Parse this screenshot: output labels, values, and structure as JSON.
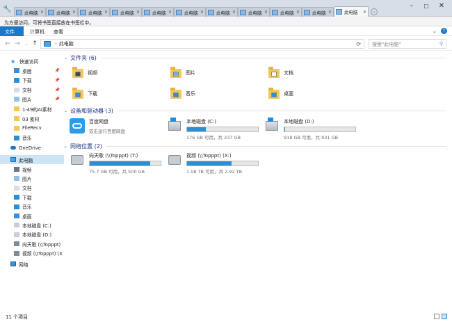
{
  "tabs": [
    {
      "label": "此电脑"
    },
    {
      "label": "此电脑"
    },
    {
      "label": "此电脑"
    },
    {
      "label": "此电脑"
    },
    {
      "label": "此电脑"
    },
    {
      "label": "此电脑"
    },
    {
      "label": "此电脑"
    },
    {
      "label": "此电脑"
    },
    {
      "label": "此电脑"
    },
    {
      "label": "此电脑"
    },
    {
      "label": "此电脑"
    }
  ],
  "notice": "为方便访问，可将书签直接放在书签栏中。",
  "ribbon": {
    "file": "文件",
    "computer": "计算机",
    "view": "查看"
  },
  "address": {
    "path": "此电脑",
    "search_placeholder": "搜索\"此电脑\""
  },
  "nav": {
    "quick_access": "快速访问",
    "qa_items": [
      {
        "label": "桌面",
        "icon": "desktop-icon",
        "pinned": true
      },
      {
        "label": "下载",
        "icon": "download-icon",
        "pinned": true
      },
      {
        "label": "文档",
        "icon": "document-icon",
        "pinned": true
      },
      {
        "label": "图片",
        "icon": "picture-icon",
        "pinned": true
      },
      {
        "label": "1-49的AI素材",
        "icon": "folder-icon"
      },
      {
        "label": "03 素材",
        "icon": "folder-icon"
      },
      {
        "label": "FileRecv",
        "icon": "folder-icon"
      },
      {
        "label": "音乐",
        "icon": "music-icon"
      }
    ],
    "onedrive": "OneDrive",
    "this_pc": "此电脑",
    "pc_items": [
      {
        "label": "视频",
        "icon": "video-icon"
      },
      {
        "label": "图片",
        "icon": "picture-icon"
      },
      {
        "label": "文档",
        "icon": "document-icon"
      },
      {
        "label": "下载",
        "icon": "download-icon"
      },
      {
        "label": "音乐",
        "icon": "music-icon"
      },
      {
        "label": "桌面",
        "icon": "desktop-icon"
      },
      {
        "label": "本地磁盘 (C:)",
        "icon": "drive-icon"
      },
      {
        "label": "本地磁盘 (D:)",
        "icon": "drive-icon"
      },
      {
        "label": "向天歌 (\\\\Topppt)",
        "icon": "network-drive-icon"
      },
      {
        "label": "视频 (\\\\Topppt) (X",
        "icon": "network-drive-icon"
      }
    ],
    "network": "网络"
  },
  "groups": {
    "folders": {
      "title": "文件夹 (6)",
      "items": [
        {
          "label": "视频",
          "badge": "video"
        },
        {
          "label": "图片",
          "badge": "picture"
        },
        {
          "label": "文档",
          "badge": "document"
        },
        {
          "label": "下载",
          "badge": "download"
        },
        {
          "label": "音乐",
          "badge": "music"
        },
        {
          "label": "桌面",
          "badge": "desktop"
        }
      ]
    },
    "devices": {
      "title": "设备和驱动器 (3)",
      "items": [
        {
          "label": "百度网盘",
          "sub": "双击运行百度网盘"
        },
        {
          "label": "本地磁盘 (C:)",
          "sub": "176 GB 可用，共 237 GB",
          "used": 0.26
        },
        {
          "label": "本地磁盘 (D:)",
          "sub": "918 GB 可用，共 931 GB",
          "used": 0.014
        }
      ]
    },
    "network": {
      "title": "网络位置 (2)",
      "items": [
        {
          "label": "向天歌 (\\\\Topppt) (T:)",
          "sub": "75.7 GB 可用，共 500 GB",
          "used": 0.85
        },
        {
          "label": "视频 (\\\\Topppt) (X:)",
          "sub": "1.08 TB 可用，共 2.92 TB",
          "used": 0.63
        }
      ]
    }
  },
  "status": "11 个项目",
  "colors": {
    "accent": "#1979ca",
    "bar": "#2b8fd6"
  }
}
